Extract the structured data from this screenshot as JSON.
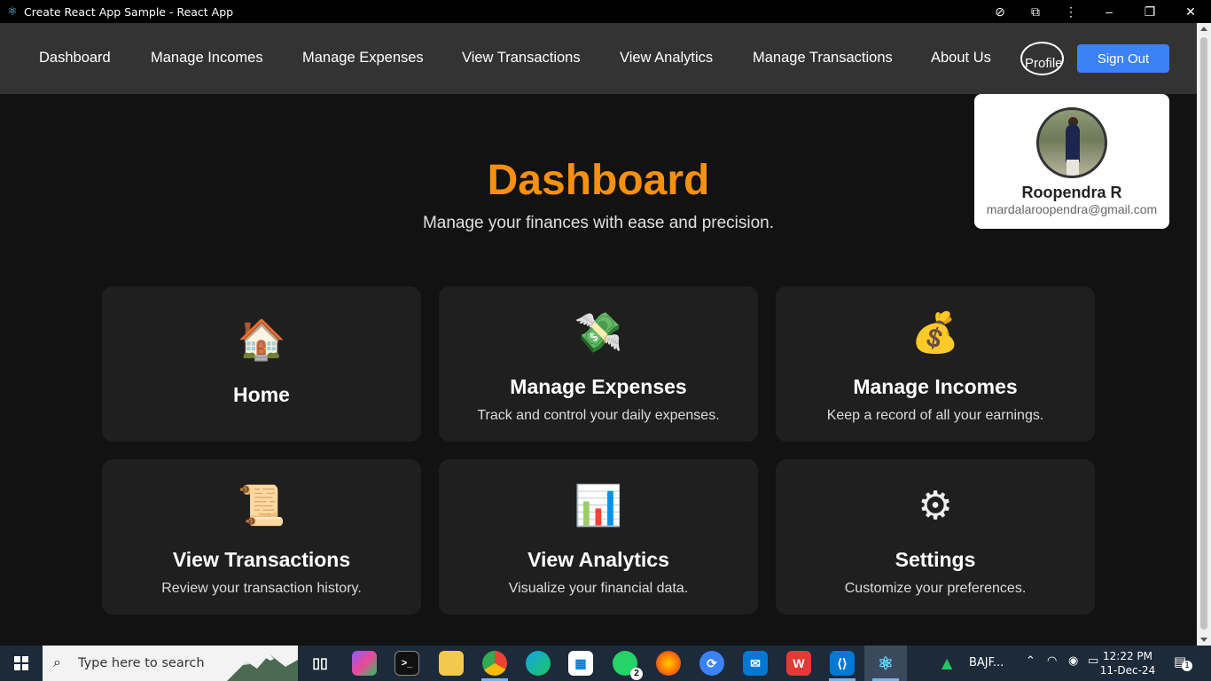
{
  "window": {
    "title": "Create React App Sample - React App",
    "icon": "react-icon"
  },
  "navbar": {
    "links": [
      {
        "label": "Dashboard"
      },
      {
        "label": "Manage Incomes"
      },
      {
        "label": "Manage Expenses"
      },
      {
        "label": "View Transactions"
      },
      {
        "label": "View Analytics"
      },
      {
        "label": "Manage Transactions"
      },
      {
        "label": "About Us"
      }
    ],
    "avatar_alt": "Profile",
    "signout_label": "Sign Out",
    "signout_color": "#3b82f6",
    "background": "#333333"
  },
  "profile": {
    "name": "Roopendra R",
    "email": "mardalaroopendra@gmail.com"
  },
  "dashboard": {
    "title": "Dashboard",
    "title_color": "#f7900f",
    "subtitle": "Manage your finances with ease and precision."
  },
  "cards": [
    {
      "icon": "house-icon",
      "emoji": "🏠",
      "title": "Home",
      "desc": ""
    },
    {
      "icon": "money-with-wings-icon",
      "emoji": "💸",
      "title": "Manage Expenses",
      "desc": "Track and control your daily expenses."
    },
    {
      "icon": "money-bag-icon",
      "emoji": "💰",
      "title": "Manage Incomes",
      "desc": "Keep a record of all your earnings."
    },
    {
      "icon": "scroll-icon",
      "emoji": "📜",
      "title": "View Transactions",
      "desc": "Review your transaction history."
    },
    {
      "icon": "bar-chart-icon",
      "emoji": "📊",
      "title": "View Analytics",
      "desc": "Visualize your financial data."
    },
    {
      "icon": "gear-icon",
      "emoji": "⚙",
      "title": "Settings",
      "desc": "Customize your preferences."
    }
  ],
  "taskbar": {
    "search_placeholder": "Type here to search",
    "whatsapp_badge": "2",
    "stock_ticker": "BAJF...",
    "time": "12:22 PM",
    "date": "11-Dec-24",
    "notification_count": "1"
  }
}
